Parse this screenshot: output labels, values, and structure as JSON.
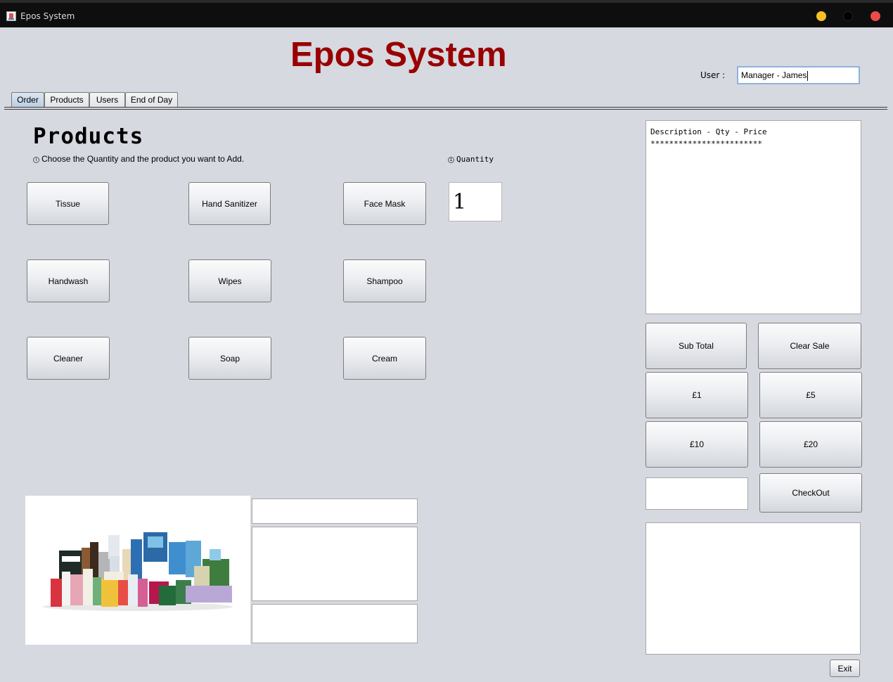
{
  "window": {
    "title": "Epos System"
  },
  "header": {
    "heading": "Epos System",
    "user_label": "User :",
    "user_value": "Manager - James"
  },
  "tabs": [
    {
      "label": "Order",
      "active": true
    },
    {
      "label": "Products",
      "active": false
    },
    {
      "label": "Users",
      "active": false
    },
    {
      "label": "End of Day",
      "active": false
    }
  ],
  "products_panel": {
    "title": "Products",
    "hint": "Choose the Quantity and the product you want to Add.",
    "quantity_label": "Quantity",
    "quantity_value": "1",
    "buttons": [
      "Tissue",
      "Hand Sanitizer",
      "Face Mask",
      "Handwash",
      "Wipes",
      "Shampoo",
      "Cleaner",
      "Soap",
      "Cream"
    ]
  },
  "receipt": {
    "header": "Description - Qty - Price",
    "divider": "************************"
  },
  "payment": {
    "subtotal": "Sub Total",
    "clear": "Clear Sale",
    "cash_1": "£1",
    "cash_5": "£5",
    "cash_10": "£10",
    "cash_20": "£20",
    "checkout": "CheckOut"
  },
  "footer": {
    "exit": "Exit"
  },
  "colors": {
    "heading": "#990000",
    "background": "#d6d9e0",
    "titlebar": "#0e0e0e"
  }
}
